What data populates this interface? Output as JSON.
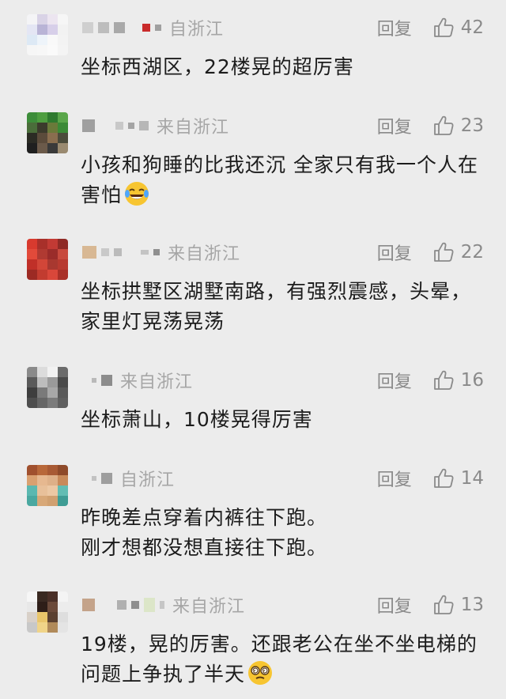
{
  "common": {
    "reply_label": "回复"
  },
  "icons": {
    "like": "thumbs-up-icon",
    "emoji_laugh": "tears-of-joy-emoji",
    "emoji_dizzy": "dizzy-face-emoji"
  },
  "colors": {
    "background": "#ececec",
    "text": "#1c1c1c",
    "muted": "#8a8a8a",
    "location": "#a6a6a6",
    "emoji_yellow": "#f7c531"
  },
  "comments": [
    {
      "location": "来自浙江",
      "location_visible": "自浙江",
      "likes": "42",
      "text": "坐标西湖区，22楼晃的超厉害"
    },
    {
      "location": "来自浙江",
      "likes": "23",
      "text": "小孩和狗睡的比我还沉 全家只有我一个人在害怕"
    },
    {
      "location": "来自浙江",
      "likes": "22",
      "text": "坐标拱墅区湖墅南路，有强烈震感，头晕，家里灯晃荡晃荡"
    },
    {
      "location": "来自浙江",
      "likes": "16",
      "text": "坐标萧山，10楼晃得厉害"
    },
    {
      "location": "来自浙江",
      "location_visible": "自浙江",
      "likes": "14",
      "text_line1": "昨晚差点穿着内裤往下跑。",
      "text_line2": "刚才想都没想直接往下跑。"
    },
    {
      "location": "来自浙江",
      "likes": "13",
      "text": "19楼，晃的厉害。还跟老公在坐不坐电梯的问题上争执了半天"
    }
  ]
}
